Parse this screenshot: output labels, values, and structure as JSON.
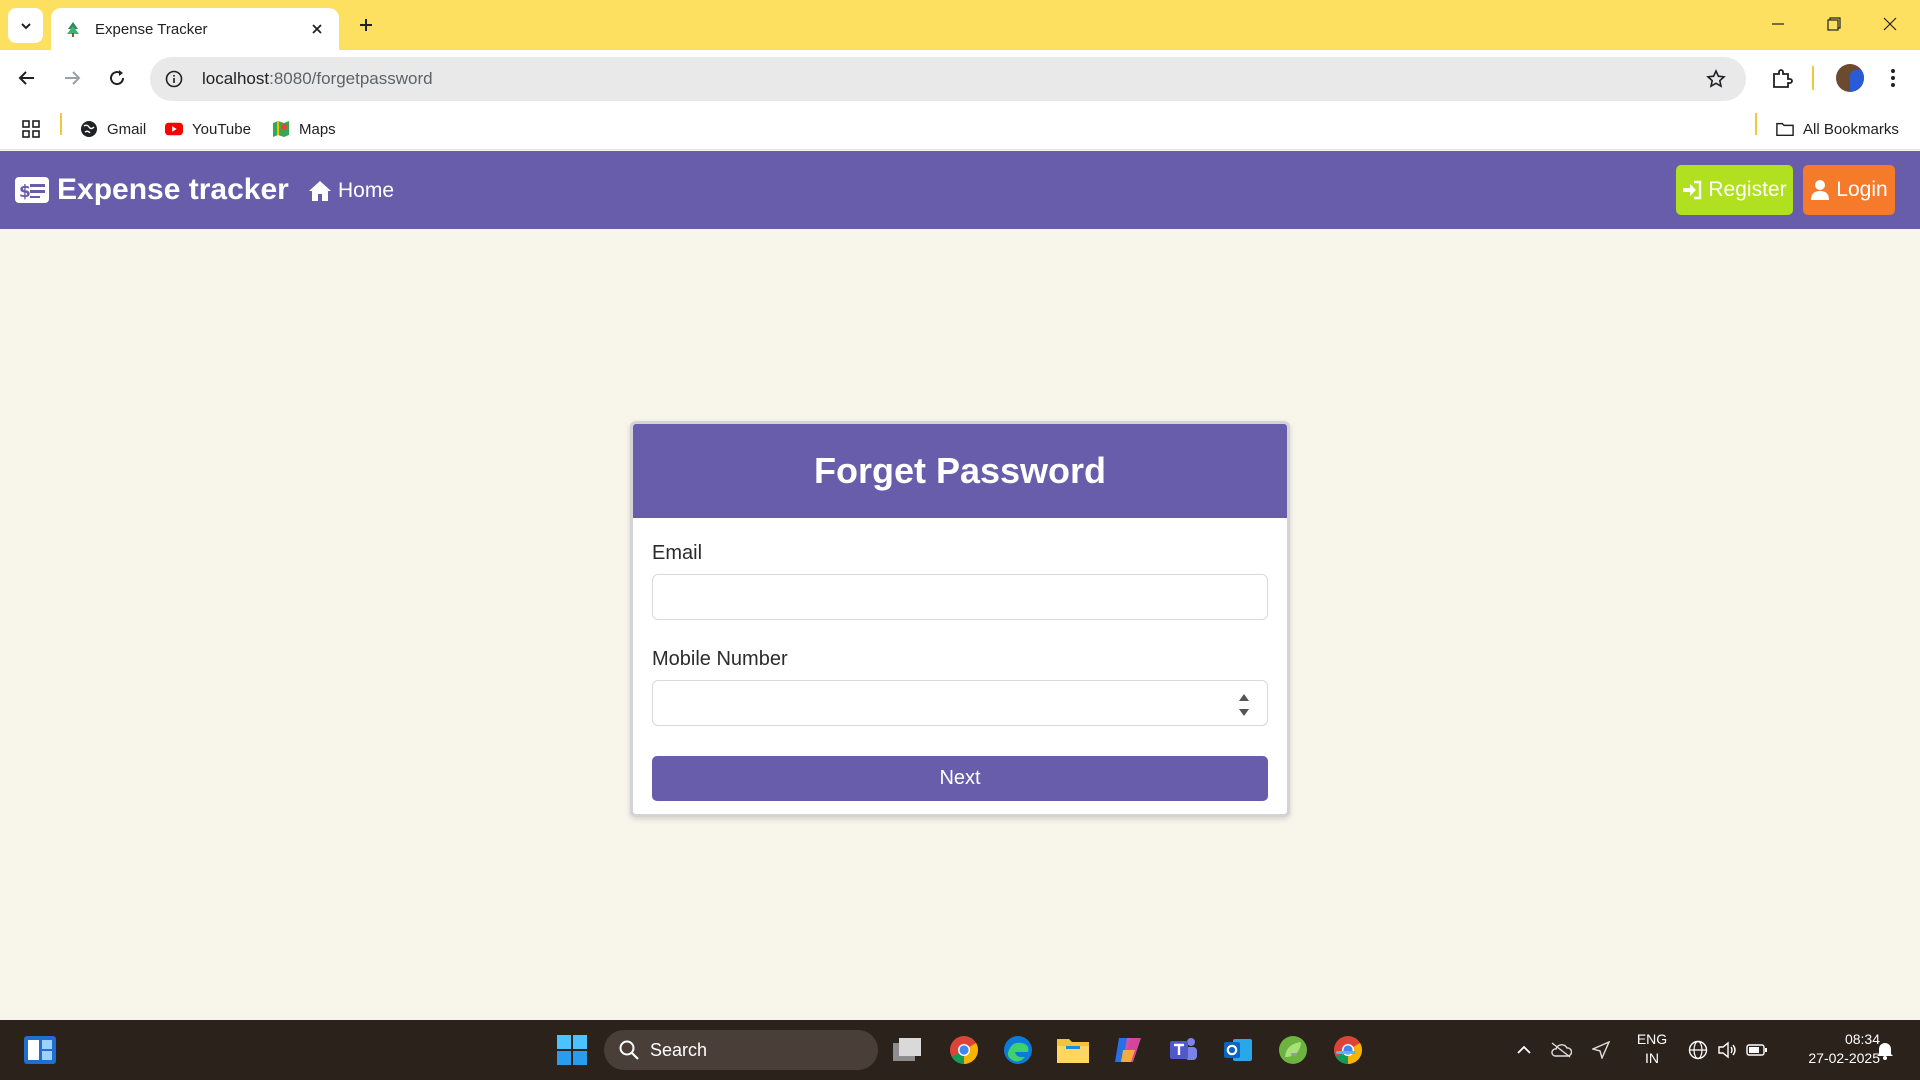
{
  "browser": {
    "tab_title": "Expense Tracker",
    "url_host": "localhost",
    "url_path": ":8080/forgetpassword",
    "bookmarks": [
      "Gmail",
      "YouTube",
      "Maps"
    ],
    "all_bookmarks_label": "All Bookmarks",
    "accent_color": "#fde05f"
  },
  "navbar": {
    "brand": "Expense tracker",
    "home_label": "Home",
    "register_label": "Register",
    "login_label": "Login",
    "bg_color": "#675daa",
    "register_color": "#b0e01f",
    "login_color": "#f57a2a"
  },
  "form": {
    "title": "Forget Password",
    "email_label": "Email",
    "email_value": "",
    "mobile_label": "Mobile Number",
    "mobile_value": "",
    "next_label": "Next"
  },
  "taskbar": {
    "search_label": "Search",
    "lang_line1": "ENG",
    "lang_line2": "IN",
    "time": "08:34",
    "date": "27-02-2025"
  }
}
